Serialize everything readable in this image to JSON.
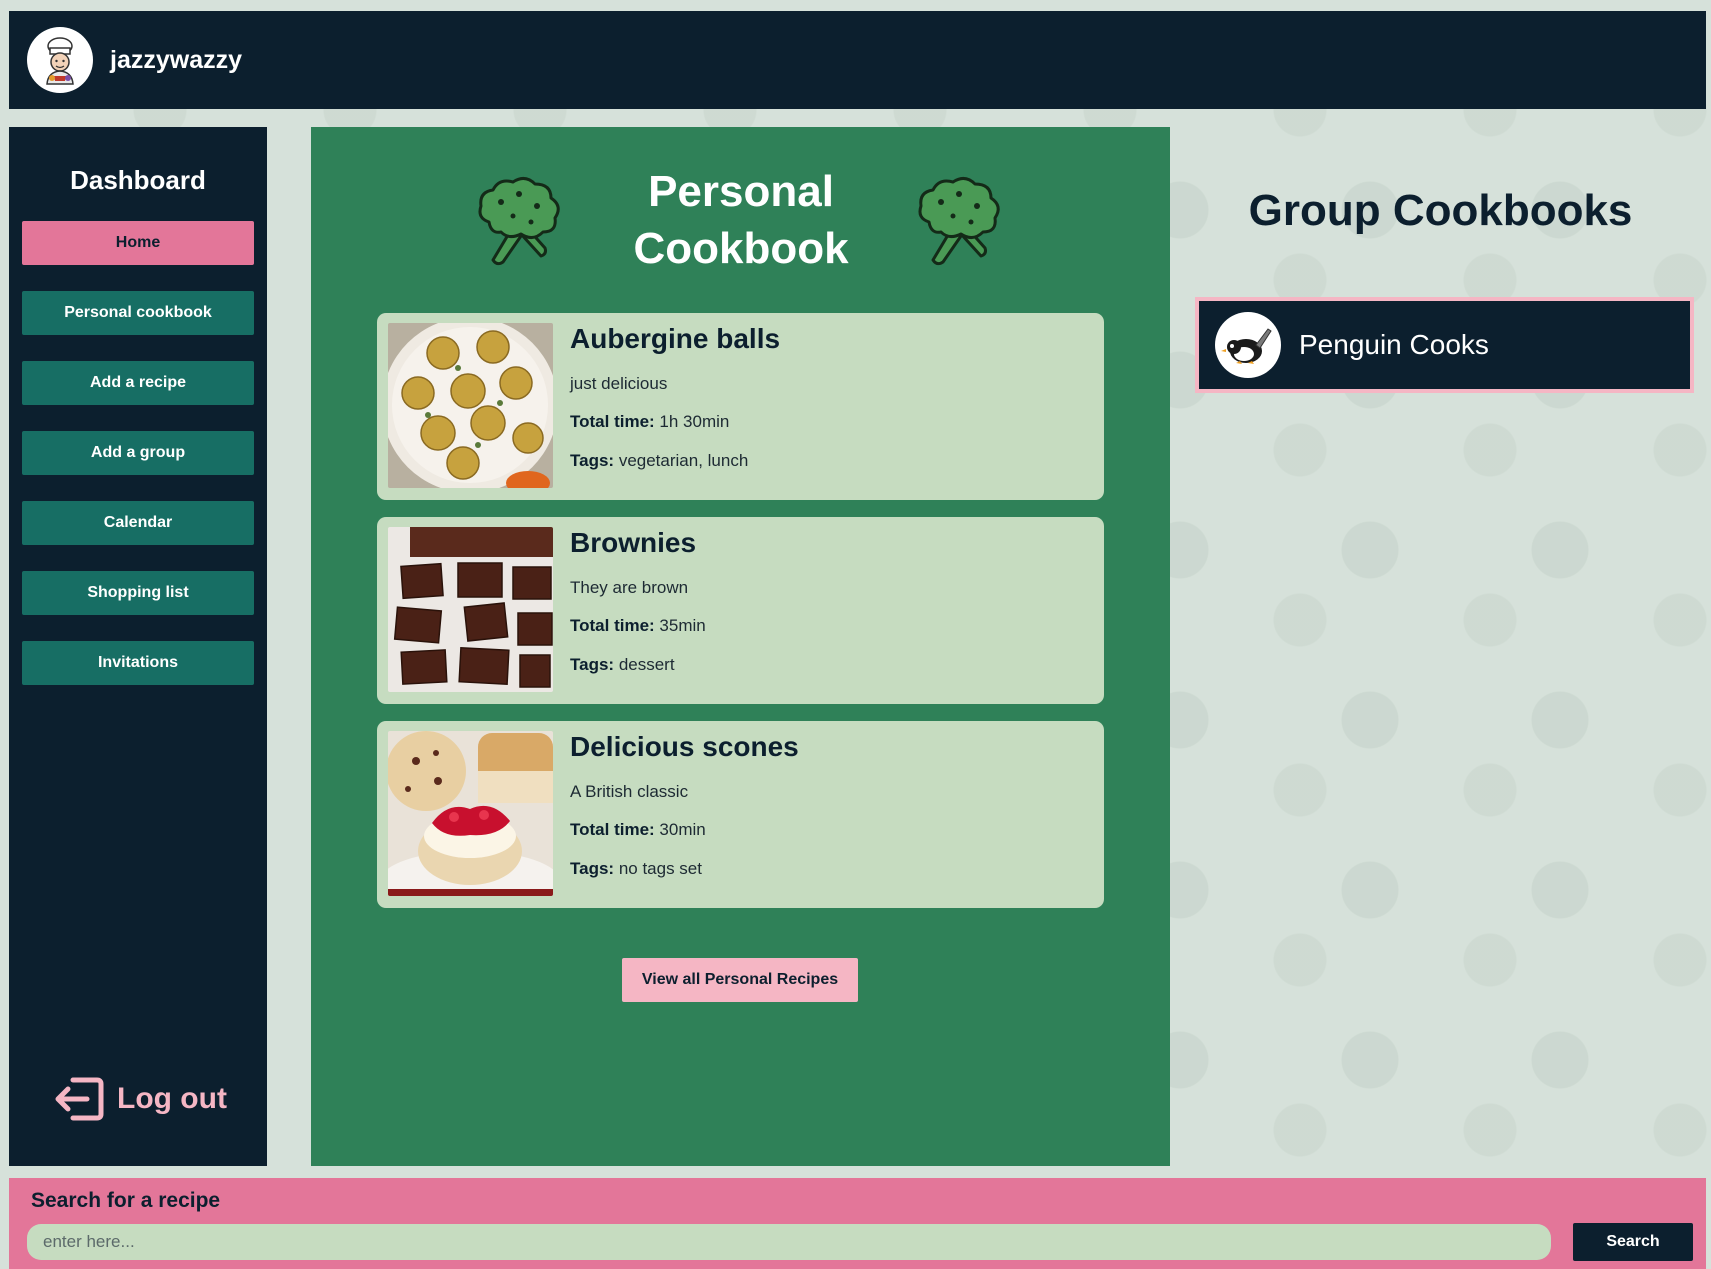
{
  "header": {
    "username": "jazzywazzy",
    "avatar_icon": "chef-avatar-icon"
  },
  "sidebar": {
    "title": "Dashboard",
    "items": [
      {
        "label": "Home",
        "active": true
      },
      {
        "label": "Personal cookbook"
      },
      {
        "label": "Add a recipe"
      },
      {
        "label": "Add a group"
      },
      {
        "label": "Calendar"
      },
      {
        "label": "Shopping list"
      },
      {
        "label": "Invitations"
      }
    ],
    "logout_label": "Log out",
    "logout_icon": "logout-icon"
  },
  "main": {
    "title_line1": "Personal",
    "title_line2": "Cookbook",
    "decor_icon": "broccoli-icon",
    "total_time_label": "Total time:",
    "tags_label": "Tags:",
    "recipes": [
      {
        "name": "Aubergine balls",
        "description": "just delicious",
        "total_time": "1h 30min",
        "tags": "vegetarian, lunch",
        "image": "aubergine-balls-photo"
      },
      {
        "name": "Brownies",
        "description": "They are brown",
        "total_time": "35min",
        "tags": "dessert",
        "image": "brownies-photo"
      },
      {
        "name": "Delicious scones",
        "description": "A British classic",
        "total_time": "30min",
        "tags": "no tags set",
        "image": "scones-photo"
      }
    ],
    "view_all_label": "View all Personal Recipes"
  },
  "groups": {
    "title": "Group Cookbooks",
    "items": [
      {
        "name": "Penguin Cooks",
        "avatar_icon": "penguin-avatar-icon"
      }
    ]
  },
  "search": {
    "label": "Search for a recipe",
    "placeholder": "enter here...",
    "value": "",
    "button_label": "Search"
  },
  "colors": {
    "navy": "#0c1f2e",
    "teal": "#176e64",
    "green_panel": "#2f8158",
    "card_green": "#c6dcc0",
    "pink": "#e37699",
    "light_pink": "#f5b6c4",
    "background": "#d6e1da"
  }
}
